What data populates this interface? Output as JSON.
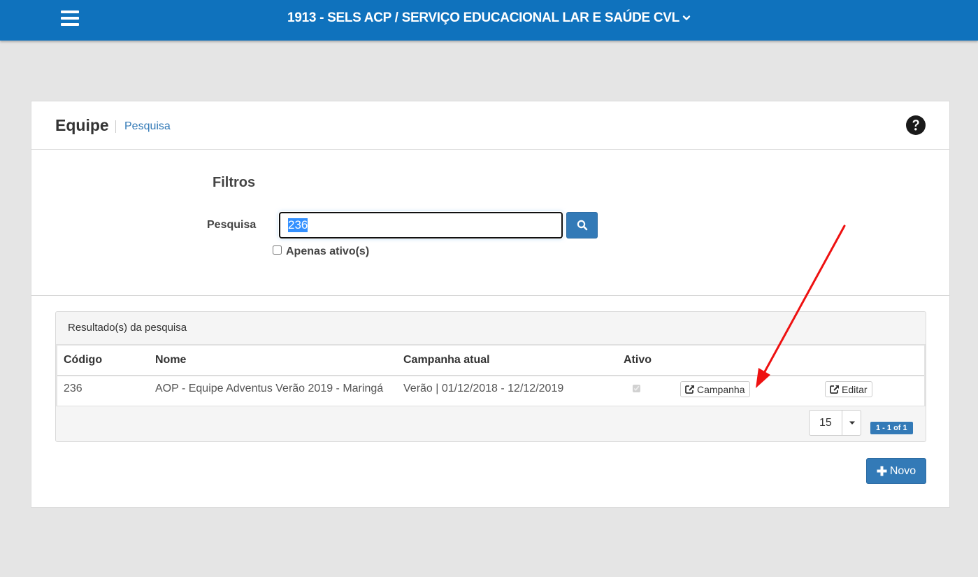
{
  "header": {
    "org_title": "1913 - SELS ACP / SERVIÇO EDUCACIONAL LAR E SAÚDE CVL"
  },
  "page": {
    "title": "Equipe",
    "breadcrumb": "Pesquisa"
  },
  "filters": {
    "title": "Filtros",
    "search_label": "Pesquisa",
    "search_value": "236",
    "only_active_label": "Apenas ativo(s)",
    "only_active_checked": false
  },
  "results": {
    "title": "Resultado(s) da pesquisa",
    "columns": [
      "Código",
      "Nome",
      "Campanha atual",
      "Ativo"
    ],
    "rows": [
      {
        "codigo": "236",
        "nome": "AOP - Equipe Adventus Verão 2019 - Maringá",
        "campanha_atual": "Verão | 01/12/2018 - 12/12/2019",
        "ativo": true,
        "campanha_button": "Campanha",
        "editar_button": "Editar"
      }
    ],
    "page_size": "15",
    "pager_info": "1 - 1 of 1"
  },
  "actions": {
    "novo_label": "Novo"
  },
  "colors": {
    "header_blue": "#0f72bd",
    "primary": "#337ab7",
    "annotation_arrow": "#ee1111"
  },
  "icons": [
    "menu-icon",
    "chevron-down-icon",
    "help-icon",
    "search-icon",
    "external-link-icon",
    "plus-icon"
  ]
}
